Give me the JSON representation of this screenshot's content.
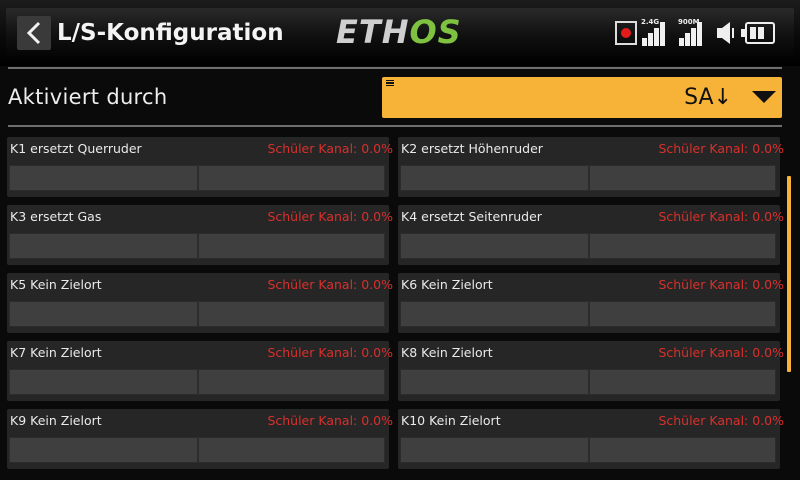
{
  "header": {
    "title": "L/S-Konfiguration",
    "logo_text_a": "ETH",
    "logo_text_b": "OS",
    "signal_24_label": "2.4G",
    "signal_900_label": "900M"
  },
  "activation": {
    "label": "Aktiviert durch",
    "value": "SA↓"
  },
  "channels": [
    {
      "name": "K1 ersetzt Querruder",
      "trainer": "Schüler Kanal: 0.0%"
    },
    {
      "name": "K2 ersetzt Höhenruder",
      "trainer": "Schüler Kanal: 0.0%"
    },
    {
      "name": "K3 ersetzt Gas",
      "trainer": "Schüler Kanal: 0.0%"
    },
    {
      "name": "K4 ersetzt Seitenruder",
      "trainer": "Schüler Kanal: 0.0%"
    },
    {
      "name": "K5 Kein Zielort",
      "trainer": "Schüler Kanal: 0.0%"
    },
    {
      "name": "K6 Kein Zielort",
      "trainer": "Schüler Kanal: 0.0%"
    },
    {
      "name": "K7 Kein Zielort",
      "trainer": "Schüler Kanal: 0.0%"
    },
    {
      "name": "K8 Kein Zielort",
      "trainer": "Schüler Kanal: 0.0%"
    },
    {
      "name": "K9 Kein Zielort",
      "trainer": "Schüler Kanal: 0.0%"
    },
    {
      "name": "K10 Kein Zielort",
      "trainer": "Schüler Kanal: 0.0%"
    }
  ],
  "colors": {
    "accent": "#f7b337",
    "trainer_text": "#d8302c",
    "logo_green": "#7fc241"
  }
}
